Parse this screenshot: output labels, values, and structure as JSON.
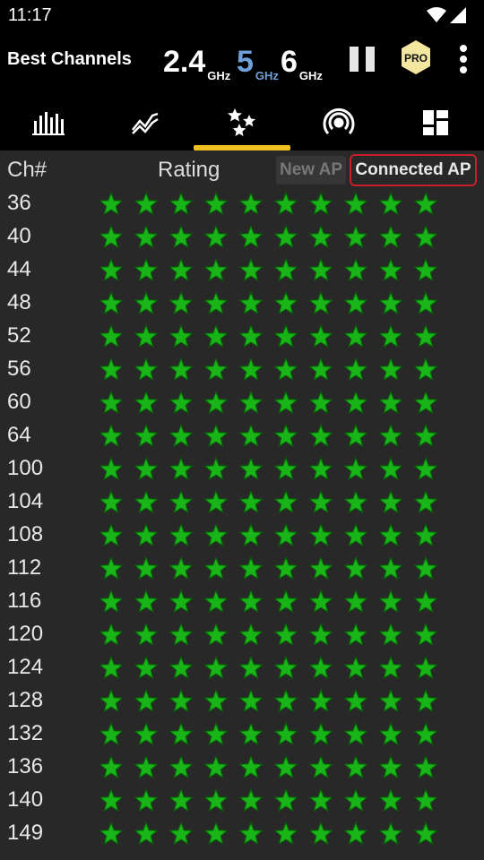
{
  "status_bar": {
    "time": "11:17"
  },
  "app_bar": {
    "title": "Best Channels",
    "bands": [
      {
        "number": "2.4",
        "unit": "GHz",
        "selected": false
      },
      {
        "number": "5",
        "unit": "GHz",
        "selected": true
      },
      {
        "number": "6",
        "unit": "GHz",
        "selected": false
      }
    ],
    "pro_label": "PRO",
    "colors": {
      "selected_band": "#6fa0d8",
      "pro_badge": "#f3e6a0"
    }
  },
  "tabs": [
    {
      "icon": "bar-chart-icon",
      "selected": false
    },
    {
      "icon": "time-graph-icon",
      "selected": false
    },
    {
      "icon": "rating-stars-icon",
      "selected": true
    },
    {
      "icon": "access-point-icon",
      "selected": false
    },
    {
      "icon": "dashboard-tiles-icon",
      "selected": false
    }
  ],
  "table": {
    "col_channel": "Ch#",
    "col_rating": "Rating",
    "new_ap_label": "New AP",
    "connected_ap_label": "Connected AP",
    "star_color": "#18b418",
    "rows": [
      {
        "ch": "36",
        "rating": 10
      },
      {
        "ch": "40",
        "rating": 10
      },
      {
        "ch": "44",
        "rating": 10
      },
      {
        "ch": "48",
        "rating": 10
      },
      {
        "ch": "52",
        "rating": 10
      },
      {
        "ch": "56",
        "rating": 10
      },
      {
        "ch": "60",
        "rating": 10
      },
      {
        "ch": "64",
        "rating": 10
      },
      {
        "ch": "100",
        "rating": 10
      },
      {
        "ch": "104",
        "rating": 10
      },
      {
        "ch": "108",
        "rating": 10
      },
      {
        "ch": "112",
        "rating": 10
      },
      {
        "ch": "116",
        "rating": 10
      },
      {
        "ch": "120",
        "rating": 10
      },
      {
        "ch": "124",
        "rating": 10
      },
      {
        "ch": "128",
        "rating": 10
      },
      {
        "ch": "132",
        "rating": 10
      },
      {
        "ch": "136",
        "rating": 10
      },
      {
        "ch": "140",
        "rating": 10
      },
      {
        "ch": "149",
        "rating": 10
      }
    ]
  }
}
